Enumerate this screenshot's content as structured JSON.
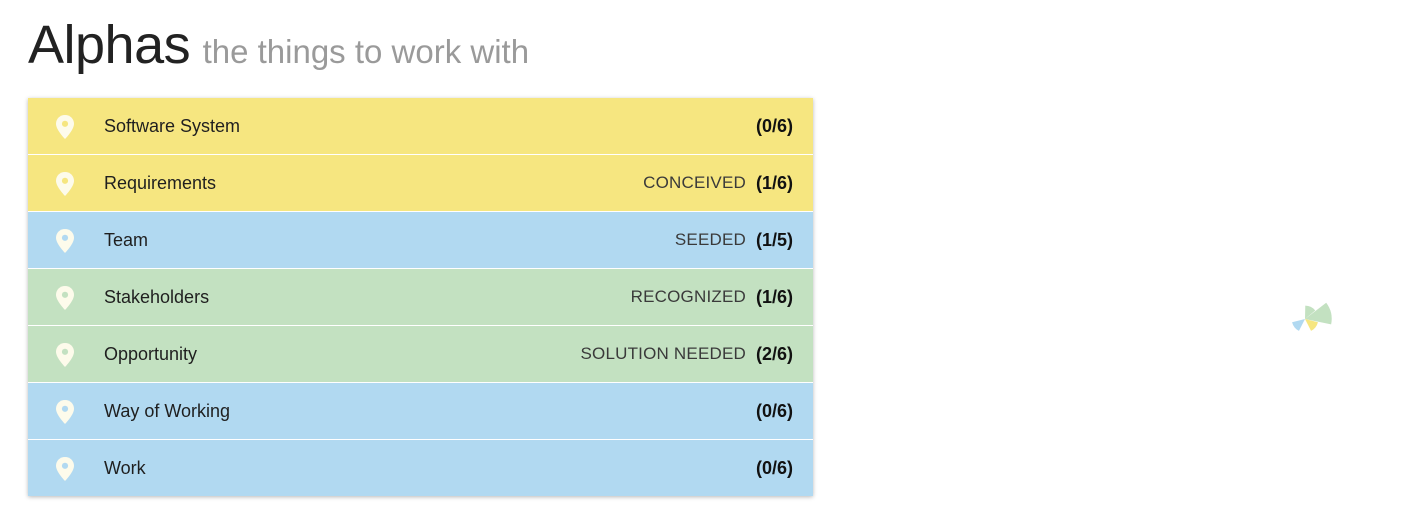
{
  "header": {
    "title": "Alphas",
    "subtitle": "the things to work with"
  },
  "colors": {
    "yellow": "#f6e680",
    "blue": "#b1d9f1",
    "green": "#c3e1c1",
    "pin": "#fdfbeb"
  },
  "alphas": [
    {
      "name": "Software System",
      "state": "",
      "count": "(0/6)",
      "color": "#f6e680",
      "icon": "map-pin-icon"
    },
    {
      "name": "Requirements",
      "state": "CONCEIVED",
      "count": "(1/6)",
      "color": "#f6e680",
      "icon": "map-pin-icon"
    },
    {
      "name": "Team",
      "state": "SEEDED",
      "count": "(1/5)",
      "color": "#b1d9f1",
      "icon": "map-pin-icon"
    },
    {
      "name": "Stakeholders",
      "state": "RECOGNIZED",
      "count": "(1/6)",
      "color": "#c3e1c1",
      "icon": "map-pin-icon"
    },
    {
      "name": "Opportunity",
      "state": "SOLUTION NEEDED",
      "count": "(2/6)",
      "color": "#c3e1c1",
      "icon": "map-pin-icon"
    },
    {
      "name": "Way of Working",
      "state": "",
      "count": "(0/6)",
      "color": "#b1d9f1",
      "icon": "map-pin-icon"
    },
    {
      "name": "Work",
      "state": "",
      "count": "(0/6)",
      "color": "#b1d9f1",
      "icon": "map-pin-icon"
    }
  ],
  "chart_data": {
    "type": "polar-area",
    "max": 6,
    "slices": [
      {
        "alpha": "Stakeholders",
        "value": 1,
        "color": "#c3e1c1"
      },
      {
        "alpha": "Opportunity",
        "value": 2,
        "color": "#c3e1c1"
      },
      {
        "alpha": "Requirements",
        "value": 1,
        "color": "#f6e680"
      },
      {
        "alpha": "Software System",
        "value": 0,
        "color": "#f6e680"
      },
      {
        "alpha": "Team",
        "value": 1,
        "color": "#b1d9f1"
      },
      {
        "alpha": "Work",
        "value": 0,
        "color": "#b1d9f1"
      },
      {
        "alpha": "Way of Working",
        "value": 0,
        "color": "#b1d9f1"
      }
    ]
  }
}
